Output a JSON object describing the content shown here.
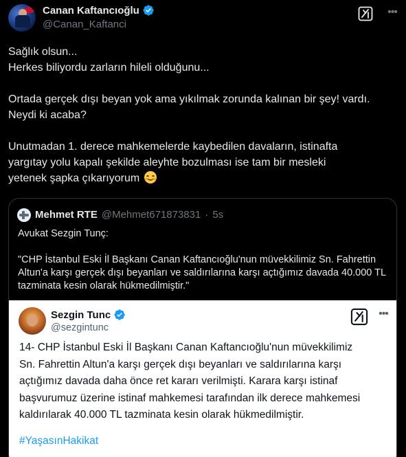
{
  "post": {
    "author": {
      "name": "Canan Kaftancıoğlu",
      "handle": "@Canan_Kaftanci",
      "verified": true
    },
    "icons": {
      "grok": "grok-icon",
      "more": "more-icon",
      "verified": "verified-icon"
    },
    "body": {
      "para1": "Sağlık olsun...\nHerkes biliyordu zarların hileli olduğunu...",
      "para2": "Ortada gerçek dışı beyan yok ama yıkılmak zorunda kalınan bir şey! vardı.\nNeydi ki acaba?",
      "para3": "Unutmadan 1. derece mahkemelerde kaybedilen davaların, istinafta\nyargıtay yolu kapalı şekilde aleyhte bozulması ise tam bir mesleki\nyetenek şapka çıkarıyorum",
      "emoji": "smiling-face-emoji"
    }
  },
  "quote": {
    "author": {
      "name": "Mehmet RTE",
      "handle": "@Mehmet671873831",
      "separator": "·",
      "time": "5s"
    },
    "text1": "Avukat Sezgin Tunç:",
    "text2": "\"CHP İstanbul Eski İl Başkanı Canan Kaftancıoğlu'nun müvekkilimiz Sn. Fahrettin Altun'a karşı gerçek dışı beyanları ve saldırılarına karşı açtığımız davada 40.000 TL tazminata kesin olarak hükmedilmiştir.\""
  },
  "screenshot": {
    "author": {
      "name": "Sezgin Tunc",
      "handle": "@sezgintunc",
      "verified": true
    },
    "text": "14- CHP İstanbul Eski İl Başkanı Canan Kaftancıoğlu'nun müvekkilimiz\nSn. Fahrettin Altun'a karşı gerçek dışı beyanları ve saldırılarına karşı\naçtığımız davada daha önce ret kararı verilmişti. Karara karşı istinaf\nbaşvurumuz üzerine istinaf mahkemesi tarafından ilk derece mahkemesi\nkaldırılarak 40.000 TL tazminata kesin olarak hükmedilmiştir.",
    "hashtag": "#YaşasınHakikat"
  },
  "colors": {
    "background": "#000000",
    "text": "#e7e9ea",
    "muted": "#71767b",
    "verified": "#1d9bf0",
    "link": "#1d9bf0",
    "border": "#2f3336"
  }
}
